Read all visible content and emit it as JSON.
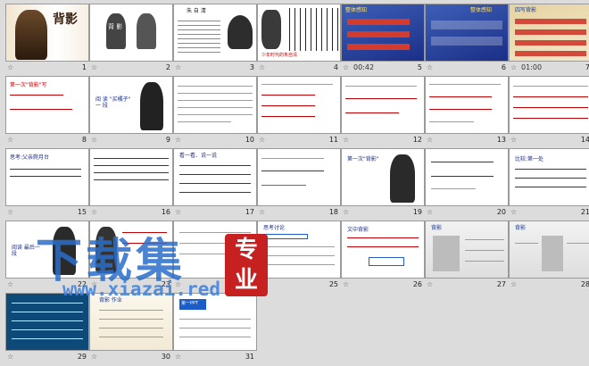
{
  "slides": [
    {
      "num": "1",
      "time": "",
      "title": "背影"
    },
    {
      "num": "2",
      "time": "",
      "title": "背 影"
    },
    {
      "num": "3",
      "time": "",
      "title": "朱 自 清"
    },
    {
      "num": "4",
      "time": "",
      "title": "少年时代的朱自清"
    },
    {
      "num": "5",
      "time": "00:42",
      "title": "整体感知"
    },
    {
      "num": "6",
      "time": "",
      "title": "整体感知"
    },
    {
      "num": "7",
      "time": "01:00",
      "title": "四写背影"
    },
    {
      "num": "8",
      "time": "",
      "title": "第一次\"背影\"写"
    },
    {
      "num": "9",
      "time": "",
      "title": "阅 读 \"买橘子\" 一 段"
    },
    {
      "num": "10",
      "time": "",
      "title": "",
      "lines": []
    },
    {
      "num": "11",
      "time": "",
      "title": ""
    },
    {
      "num": "12",
      "time": "",
      "title": ""
    },
    {
      "num": "13",
      "time": "",
      "title": ""
    },
    {
      "num": "14",
      "time": "",
      "title": ""
    },
    {
      "num": "15",
      "time": "",
      "title": "思考:父亲爬月台"
    },
    {
      "num": "16",
      "time": "",
      "title": ""
    },
    {
      "num": "17",
      "time": "",
      "title": "看一看、说一说"
    },
    {
      "num": "18",
      "time": "",
      "title": ""
    },
    {
      "num": "19",
      "time": "",
      "title": "第一次\"背影\""
    },
    {
      "num": "20",
      "time": "",
      "title": ""
    },
    {
      "num": "21",
      "time": "",
      "title": "比较:第一处"
    },
    {
      "num": "22",
      "time": "",
      "title": "阅读 最后一段"
    },
    {
      "num": "23",
      "time": "",
      "title": ""
    },
    {
      "num": "24",
      "time": "",
      "title": ""
    },
    {
      "num": "25",
      "time": "",
      "title": "思考讨论"
    },
    {
      "num": "26",
      "time": "",
      "title": "文中背影"
    },
    {
      "num": "27",
      "time": "",
      "title": "背影"
    },
    {
      "num": "28",
      "time": "",
      "title": "背影"
    },
    {
      "num": "29",
      "time": "",
      "title": ""
    },
    {
      "num": "30",
      "time": "",
      "title": "背影 作业"
    },
    {
      "num": "31",
      "time": "",
      "title": "第一PPT"
    }
  ],
  "watermark": {
    "main": "下载集",
    "url": "www.xiazai.red",
    "badge_line1": "专",
    "badge_line2": "业"
  },
  "icons": {
    "star": "☆"
  }
}
